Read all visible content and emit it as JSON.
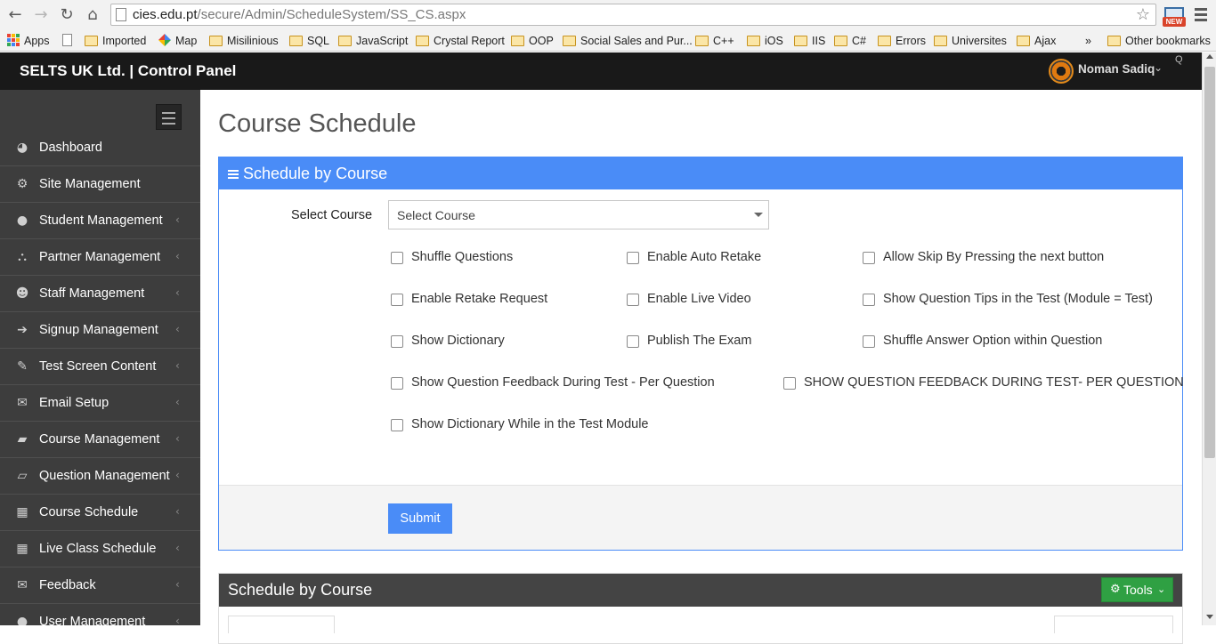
{
  "browser": {
    "url_host": "cies.edu.pt",
    "url_path": "/secure/Admin/ScheduleSystem/SS_CS.aspx",
    "back_icon": "arrow-left",
    "forward_icon": "arrow-right",
    "reload_icon": "reload",
    "home_icon": "home",
    "star_icon": "star",
    "ext_badge": "NEW",
    "bookmarks": [
      {
        "label": "Apps",
        "icon": "apps-grid"
      },
      {
        "label": "",
        "icon": "page"
      },
      {
        "label": "Imported",
        "icon": "folder"
      },
      {
        "label": "Map",
        "icon": "maps"
      },
      {
        "label": "Misilinious",
        "icon": "folder"
      },
      {
        "label": "SQL",
        "icon": "folder"
      },
      {
        "label": "JavaScript",
        "icon": "folder"
      },
      {
        "label": "Crystal Report",
        "icon": "folder"
      },
      {
        "label": "OOP",
        "icon": "folder"
      },
      {
        "label": "Social Sales and Pur...",
        "icon": "folder"
      },
      {
        "label": "C++",
        "icon": "folder"
      },
      {
        "label": "iOS",
        "icon": "folder"
      },
      {
        "label": "IIS",
        "icon": "folder"
      },
      {
        "label": "C#",
        "icon": "folder"
      },
      {
        "label": "Errors",
        "icon": "folder"
      },
      {
        "label": "Universites",
        "icon": "folder"
      },
      {
        "label": "Ajax",
        "icon": "folder"
      }
    ],
    "bookmarks_overflow": "»",
    "other_bookmarks": "Other bookmarks"
  },
  "header": {
    "brand": "SELTS UK Ltd. | Control Panel",
    "user_name": "Noman Sadiq",
    "user_caret": "⌄",
    "corner_text": "Q"
  },
  "sidebar": {
    "items": [
      {
        "label": "Dashboard",
        "icon": "dashboard-icon",
        "glyph": "◕",
        "has_arrow": false
      },
      {
        "label": "Site Management",
        "icon": "cogs-icon",
        "glyph": "⚙",
        "has_arrow": false
      },
      {
        "label": "Student Management",
        "icon": "user-icon",
        "glyph": "●",
        "has_arrow": true
      },
      {
        "label": "Partner Management",
        "icon": "sitemap-icon",
        "glyph": "⛬",
        "has_arrow": true
      },
      {
        "label": "Staff Management",
        "icon": "users-icon",
        "glyph": "☻",
        "has_arrow": true
      },
      {
        "label": "Signup Management",
        "icon": "sign-in-icon",
        "glyph": "➔",
        "has_arrow": true
      },
      {
        "label": "Test Screen Content",
        "icon": "edit-icon",
        "glyph": "✎",
        "has_arrow": true
      },
      {
        "label": "Email Setup",
        "icon": "envelope-icon",
        "glyph": "✉",
        "has_arrow": true
      },
      {
        "label": "Course Management",
        "icon": "book-icon",
        "glyph": "▰",
        "has_arrow": true
      },
      {
        "label": "Question Management",
        "icon": "folder-open-icon",
        "glyph": "▱",
        "has_arrow": true
      },
      {
        "label": "Course Schedule",
        "icon": "calendar-icon",
        "glyph": "▦",
        "has_arrow": true
      },
      {
        "label": "Live Class Schedule",
        "icon": "calendar-icon",
        "glyph": "▦",
        "has_arrow": true
      },
      {
        "label": "Feedback",
        "icon": "comments-icon",
        "glyph": "✉",
        "has_arrow": true
      },
      {
        "label": "User Management",
        "icon": "user-icon",
        "glyph": "●",
        "has_arrow": true
      }
    ],
    "arrow_glyph": "‹"
  },
  "main": {
    "page_title": "Course Schedule",
    "panel_title": "Schedule by Course",
    "select_label": "Select Course",
    "select_value": "Select Course",
    "checkboxes": {
      "shuffle_questions": "Shuffle Questions",
      "enable_auto_retake": "Enable Auto Retake",
      "allow_skip": "Allow Skip By Pressing the next button",
      "enable_retake_request": "Enable Retake Request",
      "enable_live_video": "Enable Live Video",
      "show_question_tips": "Show Question Tips in the Test (Module = Test)",
      "show_dictionary": "Show Dictionary",
      "publish_the_exam": "Publish The Exam",
      "shuffle_answer_option": "Shuffle Answer Option within Question",
      "show_question_feedback": "Show Question Feedback During Test - Per Question",
      "show_question_feedback_caps": "SHOW QUESTION FEEDBACK DURING TEST- PER QUESTION",
      "show_dictionary_test_module": "Show Dictionary While in the Test Module"
    },
    "submit_label": "Submit",
    "panel2_title": "Schedule by Course",
    "tools_label": "Tools"
  },
  "colors": {
    "accent": "#4a8cf7",
    "header_bg": "#191919",
    "sidebar_bg": "#3d3d3d",
    "tools_green": "#2fa043",
    "panel2_head": "#444444"
  }
}
